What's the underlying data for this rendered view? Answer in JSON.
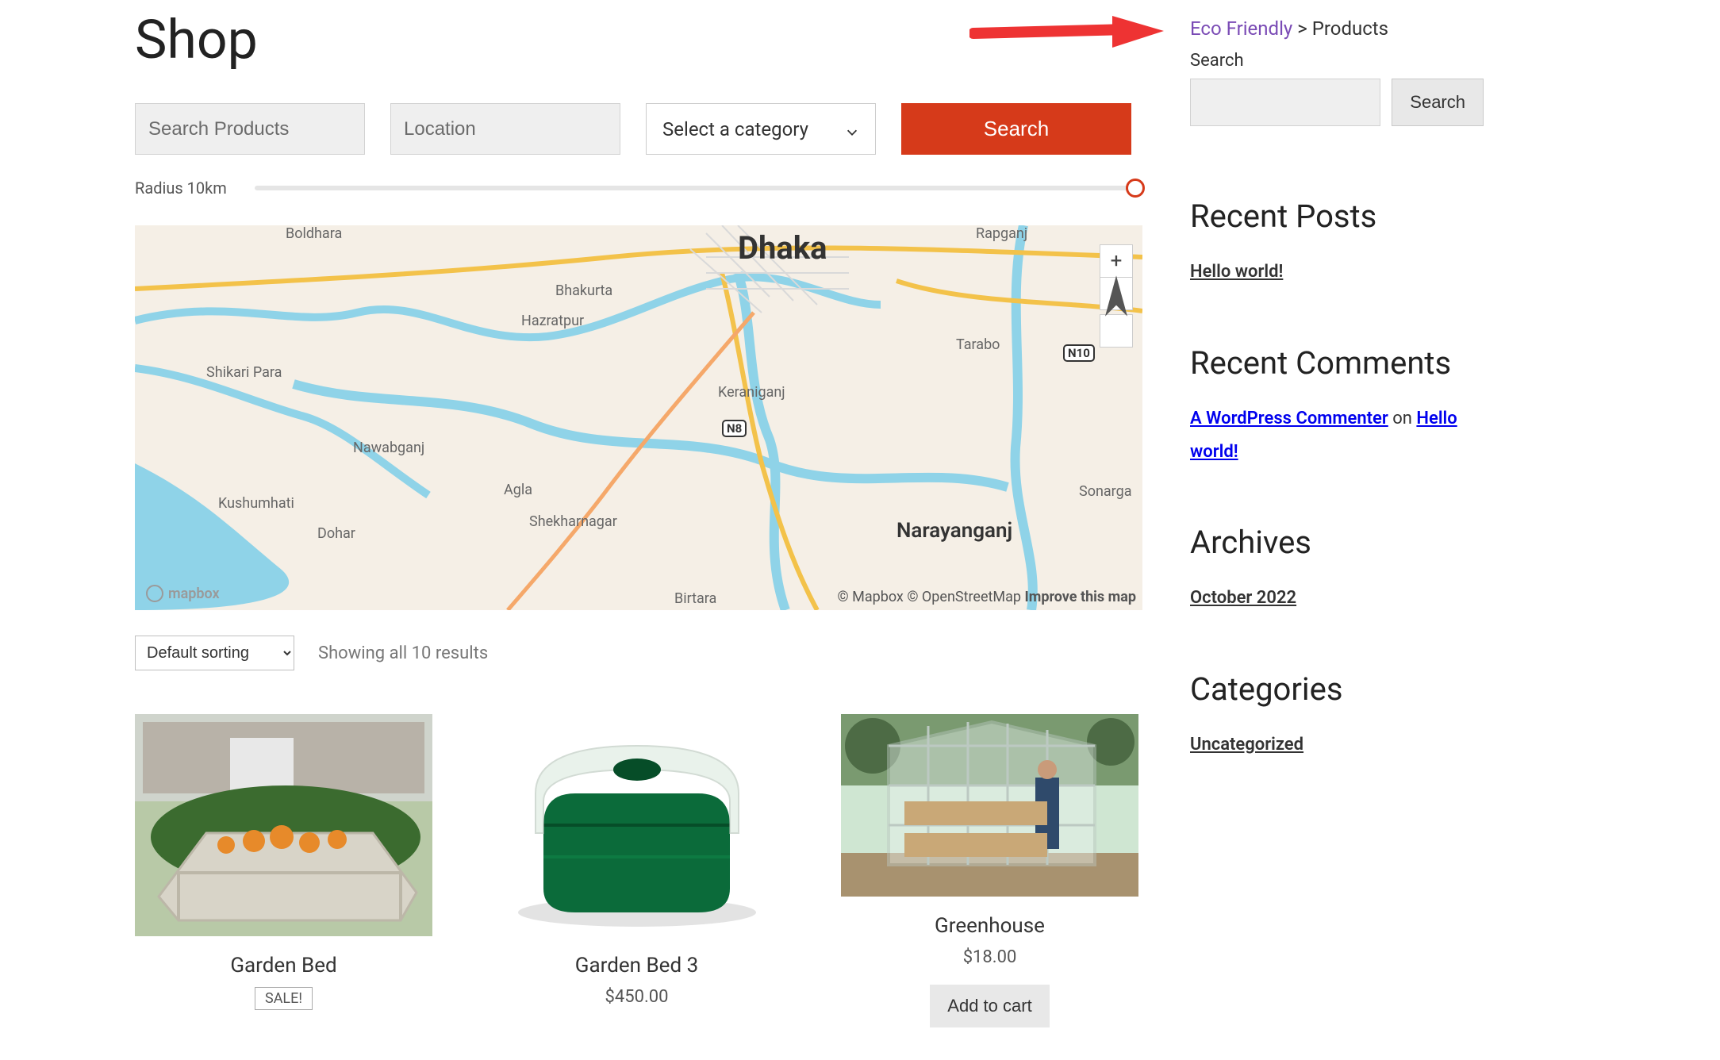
{
  "header": {
    "title": "Shop"
  },
  "search": {
    "products_placeholder": "Search Products",
    "location_placeholder": "Location",
    "category_label": "Select a category",
    "button_label": "Search",
    "radius_label": "Radius 10km"
  },
  "map": {
    "labels": {
      "dhaka": "Dhaka",
      "narayanganj": "Narayanganj",
      "keraniganj": "Keraniganj",
      "nawabganj": "Nawabganj",
      "tarabo": "Tarabo",
      "sonarga": "Sonarga",
      "bhakurta": "Bhakurta",
      "hazratpur": "Hazratpur",
      "agla": "Agla",
      "kushumhati": "Kushumhati",
      "dohar": "Dohar",
      "shekharnagar": "Shekharnagar",
      "shikari_para": "Shikari Para",
      "birtara": "Birtara",
      "rapganj": "Rapganj",
      "boldhara": "Boldhara"
    },
    "route_badges": {
      "n8": "N8",
      "n10": "N10"
    },
    "mapbox_logo": "mapbox",
    "attrib_mapbox": "© Mapbox",
    "attrib_osm": "© OpenStreetMap",
    "attrib_improve": "Improve this map"
  },
  "results": {
    "sort_label": "Default sorting",
    "showing": "Showing all 10 results"
  },
  "products": [
    {
      "title": "Garden Bed",
      "price": "",
      "sale": "SALE!"
    },
    {
      "title": "Garden Bed 3",
      "price": "$450.00",
      "sale": ""
    },
    {
      "title": "Greenhouse",
      "price": "$18.00",
      "sale": "",
      "cta": "Add to cart"
    }
  ],
  "breadcrumb": {
    "root": "Eco Friendly",
    "sep": " > ",
    "current": "Products"
  },
  "sidebar": {
    "search_label": "Search",
    "search_button": "Search",
    "recent_posts_heading": "Recent Posts",
    "recent_posts": [
      "Hello world!"
    ],
    "recent_comments_heading": "Recent Comments",
    "commenter": "A WordPress Commenter",
    "on_word": " on ",
    "comment_post": "Hello world!",
    "archives_heading": "Archives",
    "archives": [
      "October 2022"
    ],
    "categories_heading": "Categories",
    "categories": [
      "Uncategorized"
    ]
  }
}
